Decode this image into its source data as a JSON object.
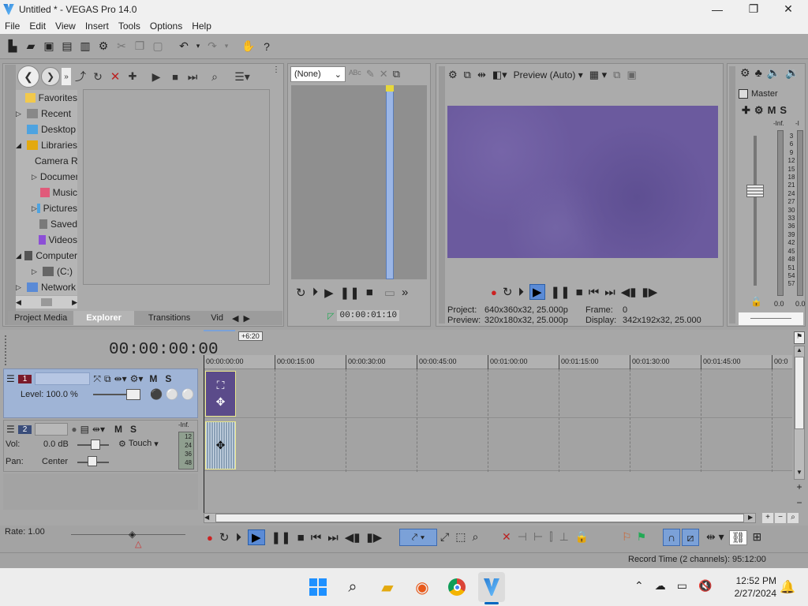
{
  "window": {
    "title": "Untitled * - VEGAS Pro 14.0",
    "minimize": "—",
    "maximize": "❐",
    "close": "✕"
  },
  "menu": [
    "File",
    "Edit",
    "View",
    "Insert",
    "Tools",
    "Options",
    "Help"
  ],
  "explorer": {
    "tree": [
      {
        "label": "Favorites",
        "indent": 0,
        "expander": ""
      },
      {
        "label": "Recent",
        "indent": 0,
        "expander": "▷"
      },
      {
        "label": "Desktop",
        "indent": 0,
        "expander": ""
      },
      {
        "label": "Libraries",
        "indent": 0,
        "expander": "◢"
      },
      {
        "label": "Camera Roll",
        "indent": 1,
        "expander": ""
      },
      {
        "label": "Documents",
        "indent": 1,
        "expander": "▷"
      },
      {
        "label": "Music",
        "indent": 1,
        "expander": ""
      },
      {
        "label": "Pictures",
        "indent": 1,
        "expander": "▷"
      },
      {
        "label": "Saved",
        "indent": 1,
        "expander": ""
      },
      {
        "label": "Videos",
        "indent": 1,
        "expander": ""
      },
      {
        "label": "Computer",
        "indent": 0,
        "expander": "◢"
      },
      {
        "label": "(C:)",
        "indent": 1,
        "expander": "▷"
      },
      {
        "label": "Network",
        "indent": 0,
        "expander": "▷"
      }
    ],
    "tabs": [
      "Project Media",
      "Explorer",
      "Transitions",
      "Vid"
    ]
  },
  "trimmer": {
    "dropdown": "(None)",
    "timecode": "00:00:01:10"
  },
  "preview": {
    "mode": "Preview (Auto)",
    "project_label": "Project:",
    "project_value": "640x360x32, 25.000p",
    "preview_label": "Preview:",
    "preview_value": "320x180x32, 25.000p",
    "frame_label": "Frame:",
    "frame_value": "0",
    "display_label": "Display:",
    "display_value": "342x192x32, 25.000"
  },
  "master": {
    "label": "Master",
    "m": "M",
    "s": "S",
    "inf": "-Inf.",
    "scale": [
      "3",
      "6",
      "9",
      "12",
      "15",
      "18",
      "21",
      "24",
      "27",
      "30",
      "33",
      "36",
      "39",
      "42",
      "45",
      "48",
      "51",
      "54",
      "57"
    ],
    "left_val": "0.0",
    "right_val": "0.0"
  },
  "timeline": {
    "timecode": "00:00:00:00",
    "offset": "+6:20",
    "ruler": [
      "00:00:00:00",
      "00:00:15:00",
      "00:00:30:00",
      "00:00:45:00",
      "00:01:00:00",
      "00:01:15:00",
      "00:01:30:00",
      "00:01:45:00",
      "00:0"
    ],
    "video_track": {
      "number": "1",
      "level": "Level: 100.0 %",
      "m": "M",
      "s": "S"
    },
    "audio_track": {
      "number": "2",
      "vol_label": "Vol:",
      "vol_value": "0.0 dB",
      "pan_label": "Pan:",
      "pan_value": "Center",
      "mode": "Touch",
      "m": "M",
      "s": "S",
      "inf": "-Inf.",
      "meter": [
        "12",
        "24",
        "36",
        "48"
      ]
    },
    "rate": "Rate: 1.00"
  },
  "status": {
    "record_time": "Record Time (2 channels): 95:12:00"
  },
  "taskbar": {
    "time": "12:52 PM",
    "date": "2/27/2024"
  },
  "colors": {
    "accent": "#4a6ea8",
    "track_video": "#9fb4d6",
    "preview_purple": "#6b5a9e",
    "clip_video": "#5b4b8a"
  }
}
